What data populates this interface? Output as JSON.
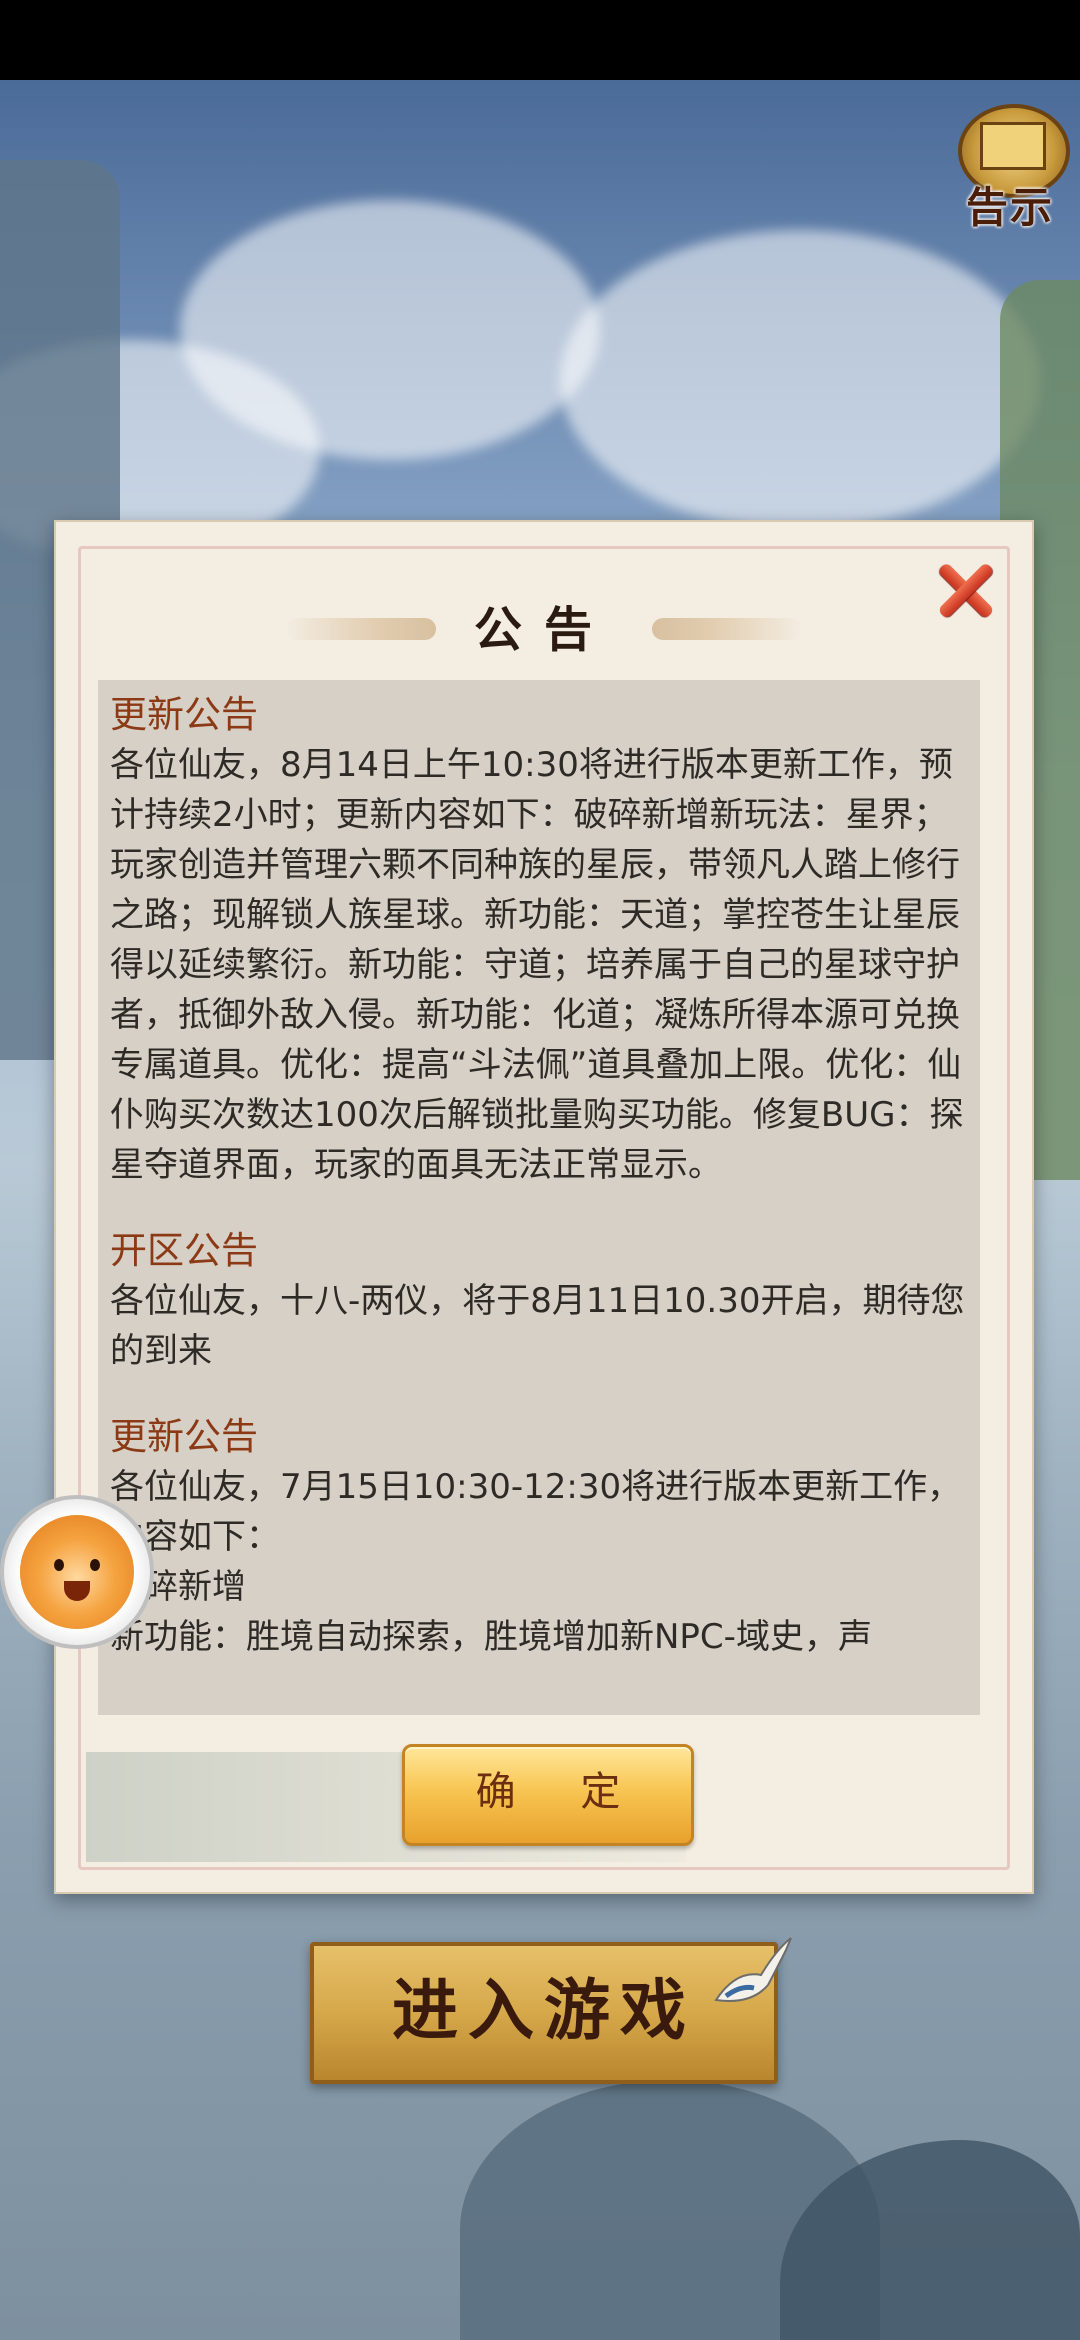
{
  "notice_icon": {
    "label": "告示"
  },
  "dialog": {
    "title": "公告",
    "confirm_label": "确 定",
    "sections": [
      {
        "heading": "更新公告",
        "body": "各位仙友，8月14日上午10:30将进行版本更新工作，预计持续2小时；更新内容如下：破碎新增新玩法：星界；玩家创造并管理六颗不同种族的星辰，带领凡人踏上修行之路；现解锁人族星球。新功能：天道；掌控苍生让星辰得以延续繁衍。新功能：守道；培养属于自己的星球守护者，抵御外敌入侵。新功能：化道；凝炼所得本源可兑换专属道具。优化：提高“斗法佩”道具叠加上限。优化：仙仆购买次数达100次后解锁批量购买功能。修复BUG：探星夺道界面，玩家的面具无法正常显示。"
      },
      {
        "heading": "开区公告",
        "body": "各位仙友，十八-两仪，将于8月11日10.30开启，期待您的到来"
      },
      {
        "heading": "更新公告",
        "body": "各位仙友，7月15日10:30-12:30将进行版本更新工作，内容如下：",
        "line2": "破碎新增",
        "line3": "新功能：胜境自动探索，胜境增加新NPC-域史，声"
      }
    ]
  },
  "enter_game": {
    "label": "进入游戏"
  },
  "colors": {
    "heading": "#8c3a16",
    "body_text": "#2e2a26",
    "panel": "#d6d0c6",
    "close": "#d8422a",
    "button_gold": "#f8c552"
  }
}
